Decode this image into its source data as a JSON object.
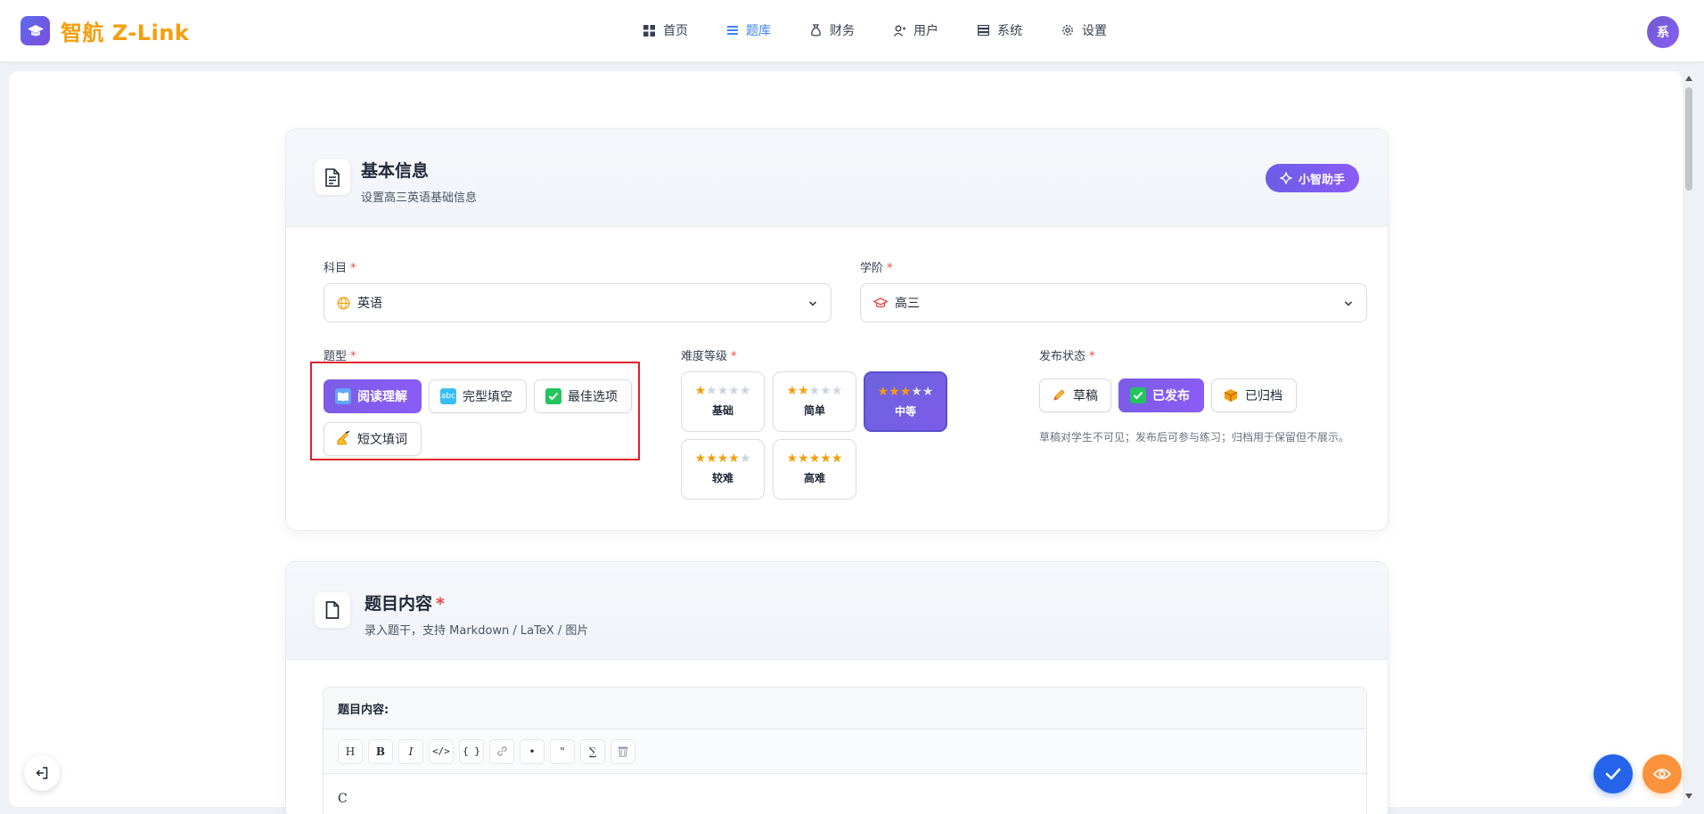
{
  "app": {
    "name": "智航 Z-Link",
    "avatar_text": "系"
  },
  "nav": [
    {
      "label": "首页",
      "icon": "grid-icon",
      "active": false
    },
    {
      "label": "题库",
      "icon": "list-icon",
      "active": true
    },
    {
      "label": "财务",
      "icon": "money-bag-icon",
      "active": false
    },
    {
      "label": "用户",
      "icon": "user-icon",
      "active": false
    },
    {
      "label": "系统",
      "icon": "server-icon",
      "active": false
    },
    {
      "label": "设置",
      "icon": "gear-icon",
      "active": false
    }
  ],
  "basic": {
    "title": "基本信息",
    "subtitle": "设置高三英语基础信息",
    "assistant_label": "小智助手",
    "subject": {
      "label": "科目",
      "value": "英语"
    },
    "grade": {
      "label": "学阶",
      "value": "高三"
    },
    "qtype": {
      "label": "题型",
      "options": [
        {
          "label": "阅读理解",
          "icon": "book-icon",
          "selected": true
        },
        {
          "label": "完型填空",
          "icon": "abc-icon",
          "selected": false
        },
        {
          "label": "最佳选项",
          "icon": "check-box-icon",
          "selected": false
        },
        {
          "label": "短文填词",
          "icon": "writing-hand-icon",
          "selected": false
        }
      ]
    },
    "difficulty": {
      "label": "难度等级",
      "levels": [
        {
          "name": "基础",
          "stars": 1,
          "selected": false
        },
        {
          "name": "简单",
          "stars": 2,
          "selected": false
        },
        {
          "name": "中等",
          "stars": 3,
          "selected": true
        },
        {
          "name": "较难",
          "stars": 4,
          "selected": false
        },
        {
          "name": "高难",
          "stars": 5,
          "selected": false
        }
      ],
      "max_stars": 5
    },
    "status": {
      "label": "发布状态",
      "options": [
        {
          "label": "草稿",
          "icon": "pencil-icon",
          "selected": false
        },
        {
          "label": "已发布",
          "icon": "check-box-icon",
          "selected": true
        },
        {
          "label": "已归档",
          "icon": "package-icon",
          "selected": false
        }
      ],
      "hint": "草稿对学生不可见；发布后可参与练习；归档用于保留但不展示。"
    }
  },
  "content": {
    "title": "题目内容",
    "subtitle": "录入题干，支持 Markdown / LaTeX / 图片",
    "editor_label": "题目内容:",
    "toolbar": [
      "H",
      "B",
      "I",
      "</>",
      "{ }",
      "link",
      "•",
      "\"",
      "∑",
      "trash"
    ],
    "body": "C"
  },
  "colors": {
    "accent": "#7c5ce8",
    "brand": "#f59e0b",
    "nav_active": "#3b82f6",
    "required": "#ef4444"
  }
}
